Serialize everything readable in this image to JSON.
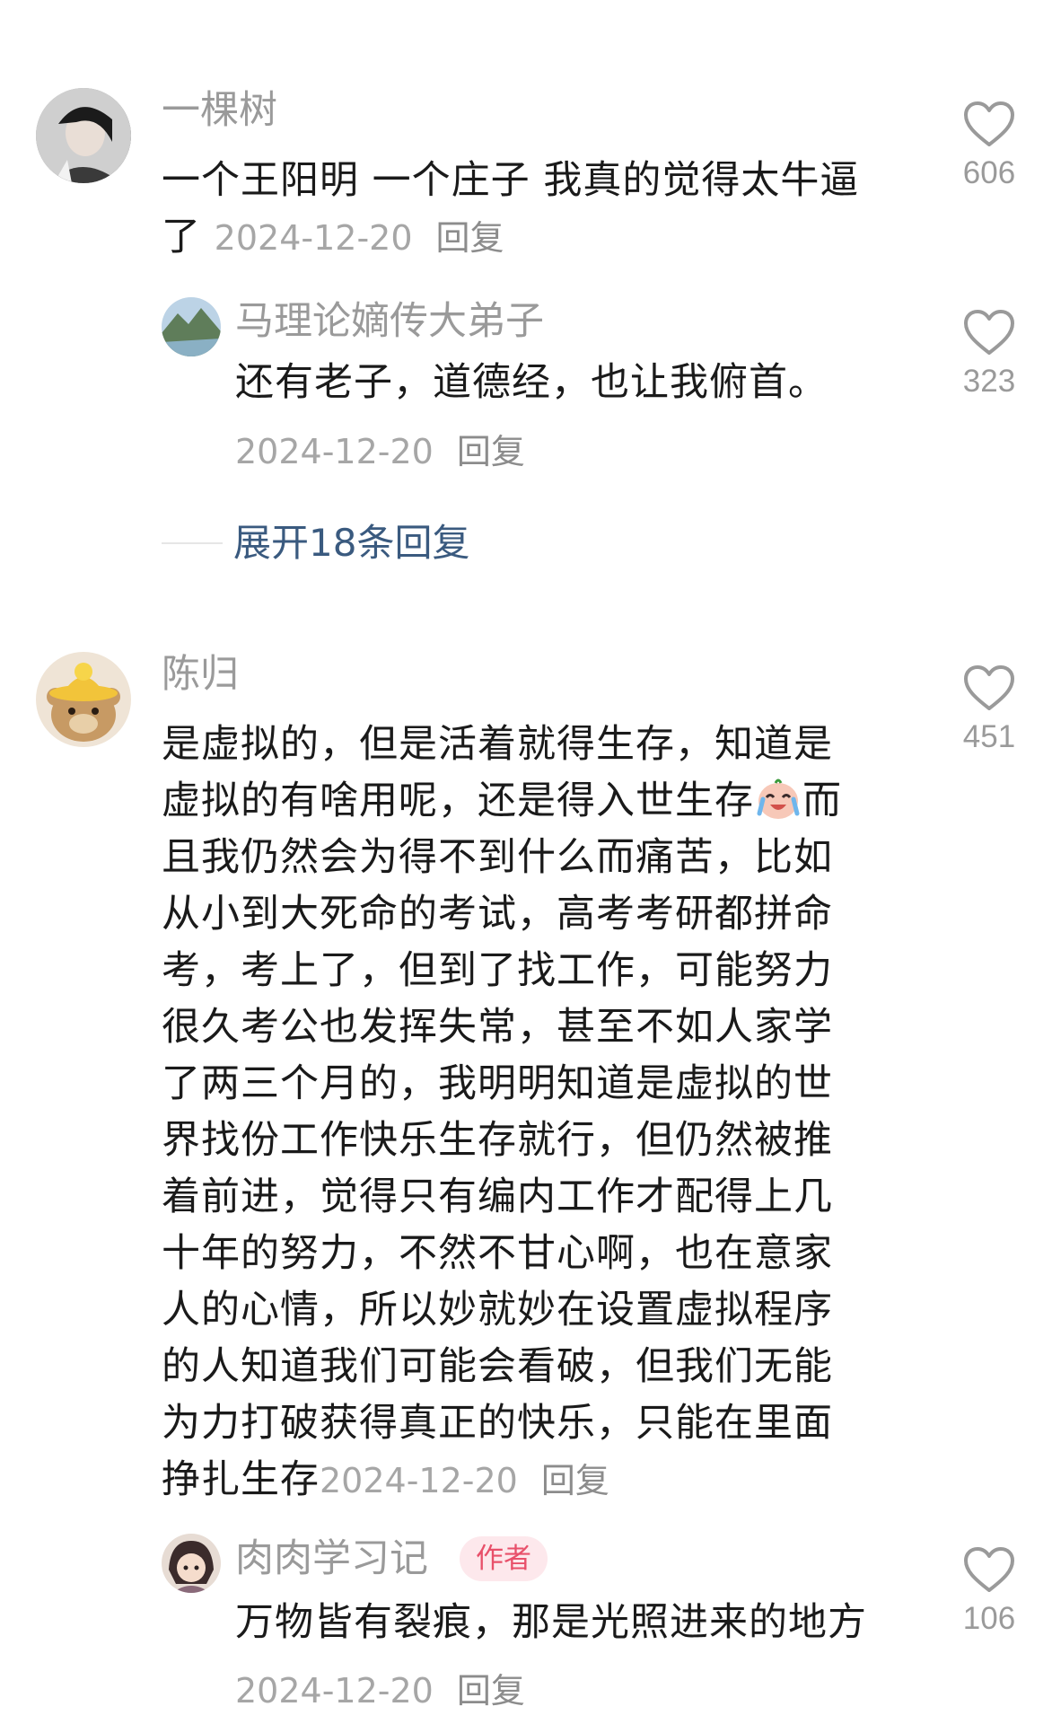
{
  "comments": [
    {
      "username": "一棵树",
      "lines": [
        "一个王阳明 一个庄子 我真的觉得太牛逼",
        "了"
      ],
      "date": "2024-12-20",
      "reply_label": "回复",
      "likes": "606",
      "reply": {
        "username": "马理论嫡传大弟子",
        "text": "还有老子，道德经，也让我俯首。",
        "date": "2024-12-20",
        "reply_label": "回复",
        "likes": "323"
      },
      "expand_label": "展开18条回复"
    },
    {
      "username": "陈归",
      "lines": [
        "是虚拟的，但是活着就得生存，知道是",
        "虚拟的有啥用呢，还是得入世生存",
        "且我仍然会为得不到什么而痛苦，比如",
        "从小到大死命的考试，高考考研都拼命",
        "考，考上了，但到了找工作，可能努力",
        "很久考公也发挥失常，甚至不如人家学",
        "了两三个月的，我明明知道是虚拟的世",
        "界找份工作快乐生存就行，但仍然被推",
        "着前进，觉得只有编内工作才配得上几",
        "十年的努力，不然不甘心啊，也在意家",
        "人的心情，所以妙就妙在设置虚拟程序",
        "的人知道我们可能会看破，但我们无能",
        "为力打破获得真正的快乐，只能在里面",
        "挣扎生存"
      ],
      "line2_tail": "而",
      "date": "2024-12-20",
      "reply_label": "回复",
      "likes": "451",
      "reply": {
        "username": "肉肉学习记",
        "badge": "作者",
        "text": "万物皆有裂痕，那是光照进来的地方",
        "date": "2024-12-20",
        "reply_label": "回复",
        "likes": "106"
      }
    }
  ],
  "icons": {
    "like": "heart-outline-icon",
    "emoji": "crying-laughing-emoji"
  },
  "colors": {
    "username": "#9a9a9a",
    "text": "#1a1a1a",
    "expand": "#3a5a7f",
    "badge_bg": "#fde8ec",
    "badge_text": "#e8506a"
  }
}
